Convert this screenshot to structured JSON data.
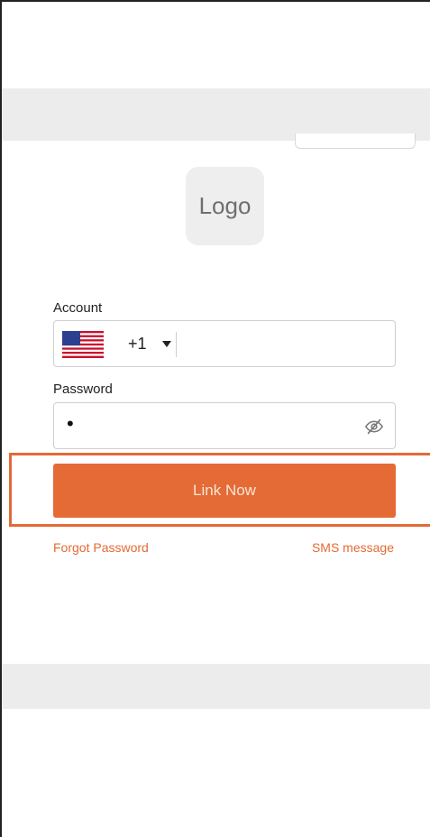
{
  "logo": {
    "text": "Logo"
  },
  "account": {
    "label": "Account",
    "country_code": "+1",
    "flag_icon": "us-flag-icon",
    "phone_value": ""
  },
  "password": {
    "label": "Password",
    "value": "•",
    "visibility_icon": "eye-slash-icon"
  },
  "actions": {
    "submit_label": "Link Now",
    "forgot_label": "Forgot Password",
    "sms_label": "SMS message"
  },
  "colors": {
    "accent": "#e46b35",
    "band": "#ececec",
    "logo_bg": "#eeeeee"
  }
}
